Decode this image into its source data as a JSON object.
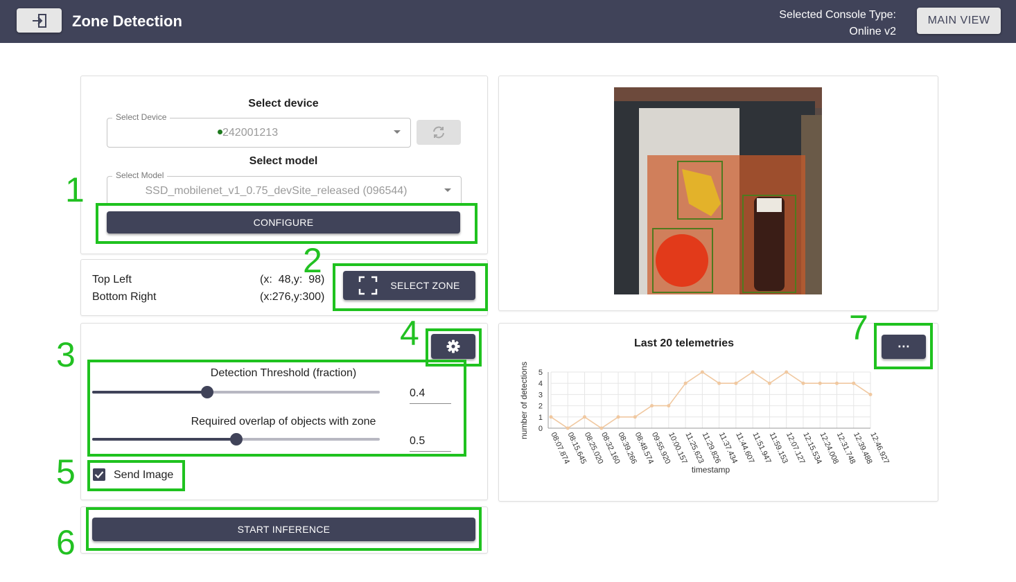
{
  "header": {
    "title": "Zone Detection",
    "console_label": "Selected Console Type:",
    "console_value": "Online v2",
    "main_view_label": "MAIN VIEW",
    "bg_color": "#404359"
  },
  "device": {
    "section_title": "Select device",
    "select_label": "Select Device",
    "value": "242001213",
    "status_color": "#1e7a1e"
  },
  "model": {
    "section_title": "Select model",
    "select_label": "Select Model",
    "value": "SSD_mobilenet_v1_0.75_devSite_released (096544)"
  },
  "configure_label": "CONFIGURE",
  "zone": {
    "top_left_label": "Top Left",
    "top_left_value": "(x:  48,y:  98)",
    "bottom_right_label": "Bottom Right",
    "bottom_right_value": "(x:276,y:300)",
    "select_zone_label": "SELECT ZONE"
  },
  "settings": {
    "threshold_label": "Detection Threshold (fraction)",
    "threshold_value": "0.4",
    "threshold_fraction": 0.4,
    "overlap_label": "Required overlap of objects with zone",
    "overlap_value": "0.5",
    "overlap_fraction": 0.5,
    "send_image_label": "Send Image",
    "send_image_checked": true
  },
  "start_inference_label": "START INFERENCE",
  "annotations": [
    "1",
    "2",
    "3",
    "4",
    "5",
    "6",
    "7"
  ],
  "annotation_color": "#1fc21f",
  "chart_data": {
    "type": "line",
    "title": "Last 20 telemetries",
    "xlabel": "timestamp",
    "ylabel": "number of detections",
    "categories": [
      "08:07.874",
      "08:15.645",
      "08:25.020",
      "08:32.160",
      "08:39.266",
      "08:48.574",
      "09:55.920",
      "10:00.157",
      "11:25.623",
      "11:29.826",
      "11:37.434",
      "11:44.607",
      "11:51.947",
      "11:59.153",
      "12:07.127",
      "12:15.534",
      "12:24.008",
      "12:31.748",
      "12:39.488",
      "12:46.927"
    ],
    "values": [
      1,
      0,
      1,
      0,
      1,
      1,
      2,
      2,
      4,
      5,
      4,
      4,
      5,
      4,
      5,
      4,
      4,
      4,
      4,
      3
    ],
    "ylim": [
      0,
      5
    ],
    "yticks": [
      0,
      1,
      2,
      3,
      4,
      5
    ],
    "grid": true,
    "line_color": "#f0c8a0"
  }
}
